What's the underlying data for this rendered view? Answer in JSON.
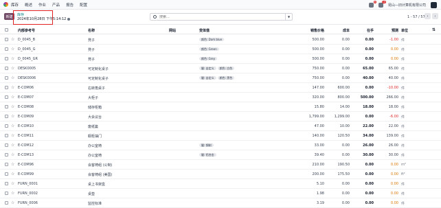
{
  "app": {
    "name": "库存"
  },
  "topmenu": [
    "概述",
    "作业",
    "产品",
    "报告",
    "配置"
  ],
  "topbar": {
    "badge1": "6",
    "badge2": "10",
    "company": "昆山—旧计算机有限公司"
  },
  "control": {
    "new_label": "新建",
    "breadcrumb_parent": "库存",
    "breadcrumb_current": "2024年10月28日 下午5:14:12",
    "search_placeholder": "搜索...",
    "pager": "1 - 57 / 57"
  },
  "columns": [
    "内部参考号",
    "名称",
    "网站",
    "变体值",
    "销售价格",
    "成本",
    "在手",
    "预测",
    "单位"
  ],
  "rows": [
    {
      "ref": "D_0045_B",
      "name": "凳子",
      "tags": [
        "颜色: Dark blue"
      ],
      "price": "500.00",
      "cost": "0.00",
      "onhand": "0.00",
      "forecast": "-1.00",
      "unit": "件",
      "fc": "red"
    },
    {
      "ref": "D_0045_G",
      "name": "凳子",
      "tags": [
        "颜色: Green"
      ],
      "price": "500.00",
      "cost": "0.00",
      "onhand": "0.00",
      "forecast": "0.00",
      "unit": "件",
      "fc": "orange"
    },
    {
      "ref": "D_0045_GR",
      "name": "凳子",
      "tags": [
        "颜色: Grey"
      ],
      "price": "500.00",
      "cost": "0.00",
      "onhand": "0.00",
      "forecast": "0.00",
      "unit": "件",
      "fc": "orange"
    },
    {
      "ref": "DESK0005",
      "name": "可定制化桌子",
      "tags": [
        "腿: 自定义",
        "颜色: 白色"
      ],
      "price": "750.00",
      "cost": "0.00",
      "onhand": "65.00",
      "forecast": "65.00",
      "unit": "件",
      "fc": ""
    },
    {
      "ref": "DESK0006",
      "name": "可定制化桌子",
      "tags": [
        "腿: 自定义",
        "颜色: 黑色"
      ],
      "price": "750.00",
      "cost": "0.00",
      "onhand": "40.00",
      "forecast": "40.00",
      "unit": "件",
      "fc": ""
    },
    {
      "ref": "E-COM06",
      "name": "右转角桌子",
      "tags": [],
      "price": "147.00",
      "cost": "600.00",
      "onhand": "0.00",
      "forecast": "-10.00",
      "unit": "件",
      "fc": "red"
    },
    {
      "ref": "E-COM07",
      "name": "大柜子",
      "tags": [],
      "price": "320.00",
      "cost": "800.00",
      "onhand": "500.00",
      "forecast": "266.00",
      "unit": "件",
      "fc": ""
    },
    {
      "ref": "E-COM08",
      "name": "储存柜箱",
      "tags": [],
      "price": "15.80",
      "cost": "14.00",
      "onhand": "18.00",
      "forecast": "18.00",
      "unit": "件",
      "fc": ""
    },
    {
      "ref": "E-COM09",
      "name": "大会议台",
      "tags": [],
      "price": "1,799.00",
      "cost": "1,299.00",
      "onhand": "0.00",
      "forecast": "-6.00",
      "unit": "件",
      "fc": "red"
    },
    {
      "ref": "E-COM10",
      "name": "废纸篓",
      "tags": [],
      "price": "47.00",
      "cost": "10.00",
      "onhand": "22.00",
      "forecast": "22.00",
      "unit": "件",
      "fc": ""
    },
    {
      "ref": "E-COM11",
      "name": "橱柜抽门",
      "tags": [],
      "price": "140.00",
      "cost": "120.50",
      "onhand": "34.00",
      "forecast": "139.00",
      "unit": "件",
      "fc": ""
    },
    {
      "ref": "E-COM12",
      "name": "办公室椅",
      "tags": [
        "腿: 钢制"
      ],
      "price": "33.00",
      "cost": "0.00",
      "onhand": "26.00",
      "forecast": "26.00",
      "unit": "件",
      "fc": ""
    },
    {
      "ref": "E-COM13",
      "name": "办公室椅",
      "tags": [
        "腿: 铝合金"
      ],
      "price": "39.40",
      "cost": "0.00",
      "onhand": "30.00",
      "forecast": "30.00",
      "unit": "件",
      "fc": ""
    },
    {
      "ref": "E-COM96",
      "name": "会客椅组 (公制)",
      "tags": [],
      "price": "210.00",
      "cost": "190.50",
      "onhand": "0.00",
      "forecast": "0.00",
      "unit": "m²",
      "fc": "orange"
    },
    {
      "ref": "E-COM99",
      "name": "会客椅组 (美国)",
      "tags": [],
      "price": "200.00",
      "cost": "175.50",
      "onhand": "0.00",
      "forecast": "0.00",
      "unit": "ft²",
      "fc": "orange"
    },
    {
      "ref": "FURN_0001",
      "name": "桌上书架盒",
      "tags": [],
      "price": "5.10",
      "cost": "0.00",
      "onhand": "0.00",
      "forecast": "0.00",
      "unit": "件",
      "fc": "orange"
    },
    {
      "ref": "FURN_0002",
      "name": "桌垫",
      "tags": [],
      "price": "1.98",
      "cost": "0.00",
      "onhand": "0.00",
      "forecast": "0.00",
      "unit": "件",
      "fc": "orange"
    },
    {
      "ref": "FURN_0006",
      "name": "监控标准",
      "tags": [],
      "price": "3.19",
      "cost": "0.00",
      "onhand": "0.00",
      "forecast": "0.00",
      "unit": "件",
      "fc": "orange"
    }
  ]
}
